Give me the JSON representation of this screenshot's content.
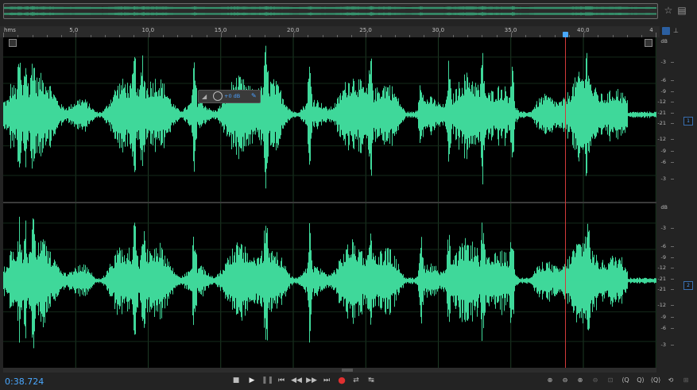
{
  "colors": {
    "waveform": "#3fd89a",
    "playhead": "#d23a3a",
    "timecode": "#4aa8ff",
    "grid": "#1d3a24",
    "accent": "#4da0ff"
  },
  "ruler": {
    "unit": "hms",
    "ticks": [
      "5,0",
      "10,0",
      "15,0",
      "20,0",
      "25,0",
      "30,0",
      "35,0",
      "40,0",
      "4"
    ]
  },
  "db_scale": {
    "unit": "dB",
    "labels": [
      "-3",
      "-6",
      "-9",
      "-12",
      "-21",
      "-21",
      "-12",
      "-9",
      "-6",
      "-3"
    ]
  },
  "channels": [
    {
      "badge": "1"
    },
    {
      "badge": "2"
    }
  ],
  "hud": {
    "gain_label": "+0 dB",
    "icons": [
      "level-meter-icon",
      "gain-knob-icon",
      "pin-icon"
    ]
  },
  "transport": {
    "timecode": "0:38.724",
    "buttons": [
      "stop-icon",
      "play-icon",
      "pause-icon",
      "go-to-start-icon",
      "rewind-icon",
      "fast-forward-icon",
      "go-to-end-icon",
      "record-icon",
      "loop-icon",
      "skip-selection-icon"
    ]
  },
  "zoom": {
    "buttons": [
      "zoom-in-amplitude-icon",
      "zoom-out-amplitude-icon",
      "zoom-in-time-icon",
      "zoom-out-time-icon",
      "zoom-selection-icon",
      "zoom-out-full-icon",
      "zoom-in-left-icon",
      "zoom-in-right-icon",
      "zoom-out-all-icon",
      "zoom-tool-icon",
      "zoom-to-selection-icon"
    ]
  },
  "playhead_time": 38.724,
  "duration": 45
}
